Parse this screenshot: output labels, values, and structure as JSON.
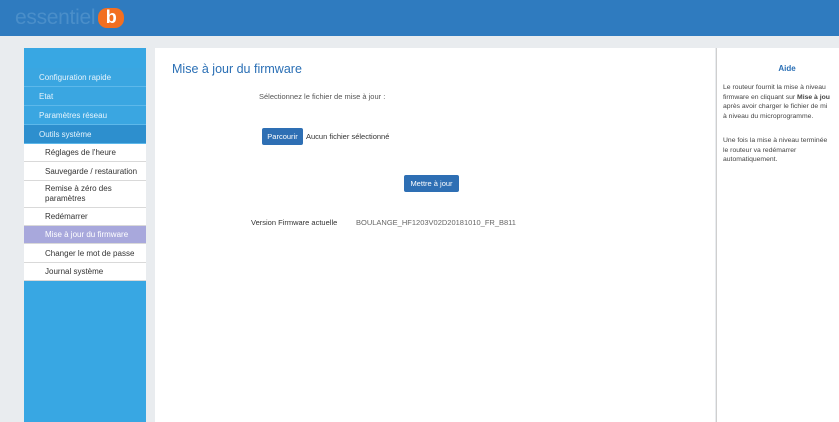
{
  "header": {
    "logo_text": "essentiel",
    "logo_badge": "b"
  },
  "sidebar": {
    "sections": [
      {
        "label": "Configuration rapide"
      },
      {
        "label": "Etat"
      },
      {
        "label": "Paramètres réseau"
      },
      {
        "label": "Outils système"
      }
    ],
    "subitems": [
      {
        "label": "Réglages de l'heure"
      },
      {
        "label": "Sauvegarde / restauration"
      },
      {
        "label": "Remise à zéro des paramètres"
      },
      {
        "label": "Redémarrer"
      },
      {
        "label": "Mise à jour du firmware"
      },
      {
        "label": "Changer le mot de passe"
      },
      {
        "label": "Journal système"
      }
    ]
  },
  "main": {
    "title": "Mise à jour du firmware",
    "select_label": "Sélectionnez le fichier de mise à jour :",
    "browse_label": "Parcourir",
    "no_file_label": "Aucun fichier sélectionné",
    "update_label": "Mettre à jour",
    "version_label": "Version Firmware actuelle",
    "version_value": "BOULANGE_HF1203V02D20181010_FR_B811"
  },
  "help": {
    "title": "Aide",
    "p1_line1": "Le routeur fournit la mise à niveau",
    "p1_line2_a": "firmware en cliquant sur ",
    "p1_line2_b": "Mise à jou",
    "p1_line3": "après avoir charger le fichier de mi",
    "p1_line4": "à niveau du microprogramme.",
    "p2_line1": "Une fois la mise à niveau terminée",
    "p2_line2": "le routeur va redémarrer",
    "p2_line3": "automatiquement."
  },
  "colors": {
    "header": "#2f7bbf",
    "sidebar": "#38a7e3",
    "accent": "#2e6fb4",
    "selected": "#a8a8dc",
    "logo_badge": "#f26f21"
  }
}
